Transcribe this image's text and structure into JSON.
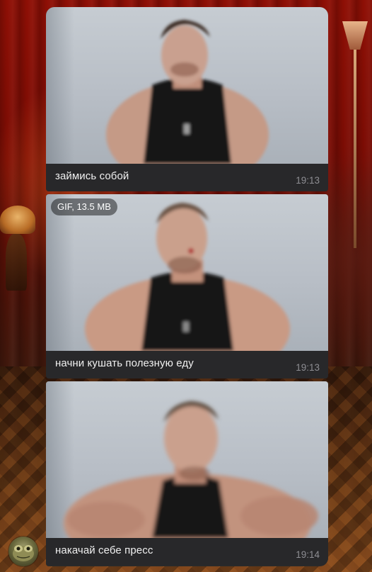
{
  "chat": {
    "messages": [
      {
        "caption": "займись собой",
        "time": "19:13"
      },
      {
        "badge": "GIF, 13.5 MB",
        "caption": "начни кушать полезную еду",
        "time": "19:13"
      },
      {
        "caption": "накачай себе пресс",
        "time": "19:14"
      }
    ]
  },
  "colors": {
    "bubble": "#2b2b2b",
    "caption_text": "#f0f0f0",
    "time_text": "#8e8e93",
    "wallpaper_red": "#8e0f05"
  }
}
